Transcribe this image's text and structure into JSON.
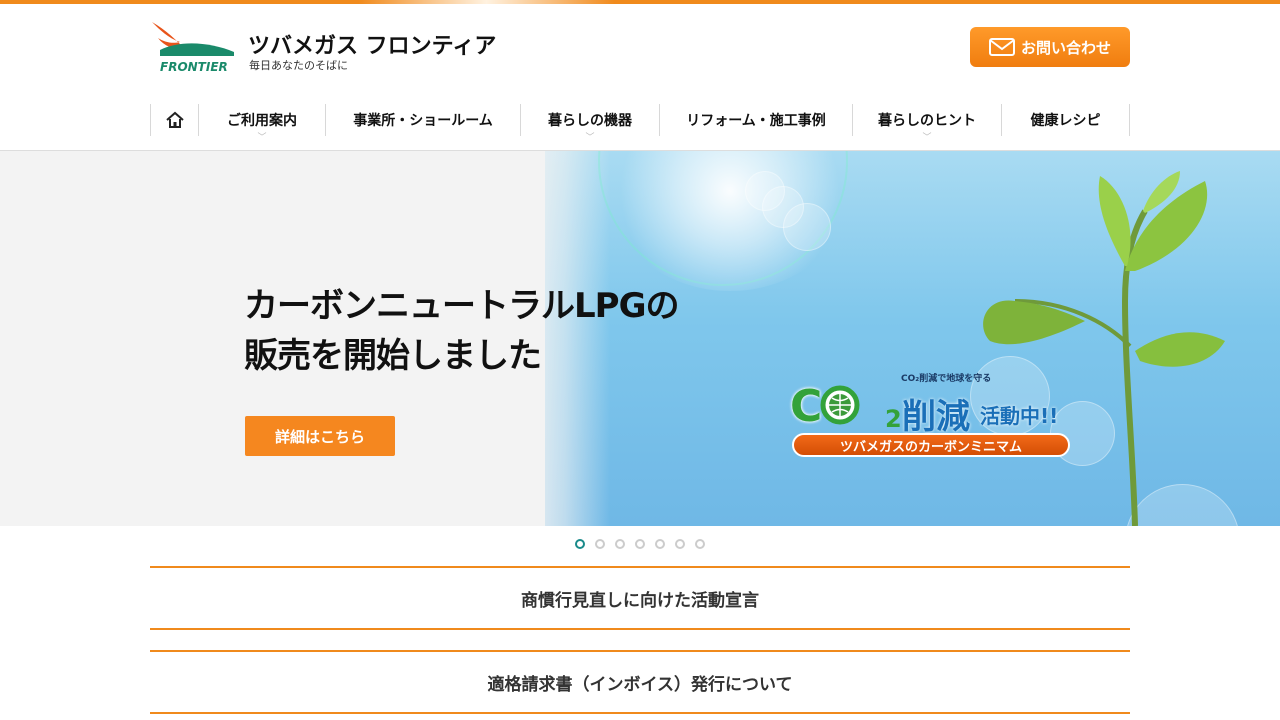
{
  "header": {
    "logo_name": "ツバメガス フロンティア",
    "logo_brand": "FRONTIER",
    "logo_tagline": "毎日あなたのそばに",
    "contact_label": "お問い合わせ",
    "accent_color": "#f08a1c"
  },
  "nav": {
    "items": [
      {
        "label": "ご利用案内",
        "icon": "",
        "has_dropdown": true
      },
      {
        "label": "事業所・ショールーム",
        "icon": "",
        "has_dropdown": false
      },
      {
        "label": "暮らしの機器",
        "icon": "",
        "has_dropdown": true
      },
      {
        "label": "リフォーム・施工事例",
        "icon": "",
        "has_dropdown": false
      },
      {
        "label": "暮らしのヒント",
        "icon": "",
        "has_dropdown": true
      },
      {
        "label": "健康レシピ",
        "icon": "",
        "has_dropdown": false
      }
    ],
    "home_icon": "home-icon"
  },
  "hero": {
    "title_line1": "カーボンニュートラルLPGの",
    "title_line2": "販売を開始しました",
    "button_label": "詳細はこちら",
    "badge": {
      "small_text": "CO₂削減で地球を守る",
      "co_text": "C",
      "sub_text": "2",
      "kanji_text": "削減",
      "kanji2_text": "活動中!!",
      "bar_text": "ツバメガスのカーボンミニマム"
    }
  },
  "slider": {
    "count": 7,
    "active_index": 0
  },
  "news": [
    {
      "title": "商慣行見直しに向けた活動宣言"
    },
    {
      "title": "適格請求書（インボイス）発行について"
    }
  ]
}
